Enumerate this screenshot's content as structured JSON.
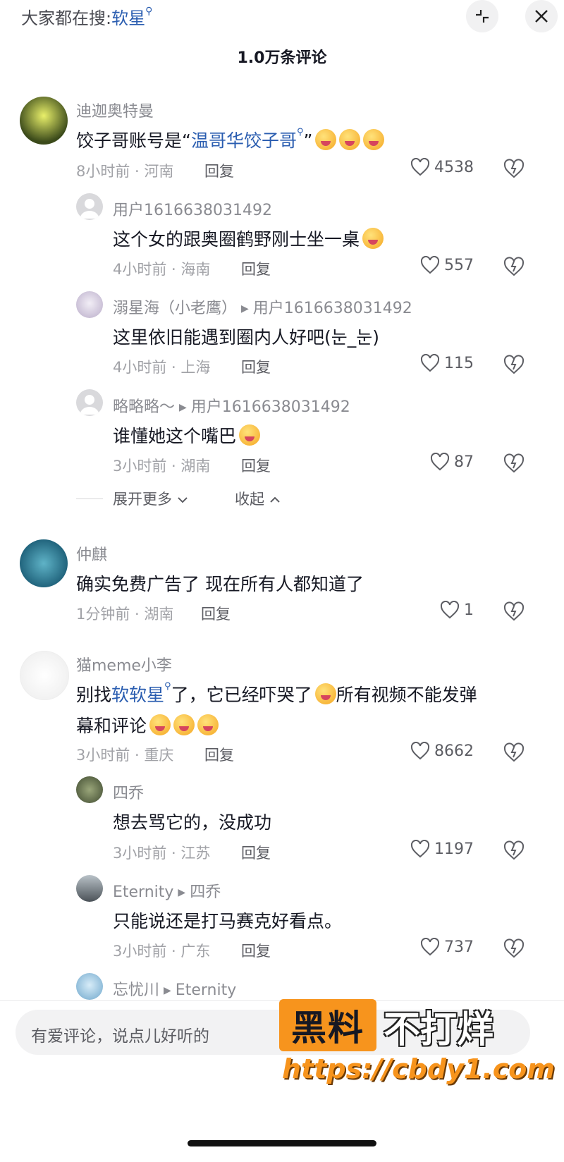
{
  "header": {
    "search_hint_prefix": "大家都在搜:",
    "search_hint_keyword": "软星",
    "comment_count": "1.0万条评论"
  },
  "colors": {
    "link": "#2a5db0",
    "text": "#161823",
    "meta": "#a1a2a7",
    "watermark_orange": "#f7941d"
  },
  "icons": [
    "search-icon",
    "collapse-icon",
    "close-icon",
    "heart-icon",
    "dislike-heart-icon",
    "chevron-down-icon",
    "chevron-up-icon",
    "play-triangle-icon"
  ],
  "comments": {
    "c1": {
      "username": "迪迦奥特曼",
      "text_a": "饺子哥账号是“",
      "text_link": "温哥华饺子哥",
      "text_b": "”",
      "time_location": "8小时前 · 河南",
      "reply": "回复",
      "likes": "4538"
    },
    "r1": {
      "username": "用户1616638031492",
      "text": "这个女的跟奥圈鹤野刚士坐一桌",
      "time_location": "4小时前 · 海南",
      "reply": "回复",
      "likes": "557"
    },
    "r2": {
      "username": "溺星海（小老鹰）",
      "reply_to": "用户1616638031492",
      "text": "这里依旧能遇到圈内人好吧(눈_눈)",
      "time_location": "4小时前 · 上海",
      "reply": "回复",
      "likes": "115"
    },
    "r3": {
      "username": "略略略～",
      "reply_to": "用户1616638031492",
      "text": "谁懂她这个嘴巴",
      "time_location": "3小时前 · 湖南",
      "reply": "回复",
      "likes": "87"
    },
    "expand_more": "展开更多",
    "collapse": "收起",
    "c2": {
      "username": "仲麒",
      "text": "确实免费广告了  现在所有人都知道了",
      "time_location": "1分钟前 · 湖南",
      "reply": "回复",
      "likes": "1"
    },
    "c3": {
      "username": "猫meme小李",
      "text_a": "别找",
      "text_link": "软软星",
      "text_b": "了，它已经吓哭了",
      "text_c": "所有视频不能发弹",
      "text_line2": "幕和评论",
      "time_location": "3小时前 · 重庆",
      "reply": "回复",
      "likes": "8662"
    },
    "r4": {
      "username": "四乔",
      "text": "想去骂它的，没成功",
      "time_location": "3小时前 · 江苏",
      "reply": "回复",
      "likes": "1197"
    },
    "r5": {
      "username": "Eternity",
      "reply_to": "四乔",
      "text": "只能说还是打马赛克好看点。",
      "time_location": "3小时前 · 广东",
      "reply": "回复",
      "likes": "737"
    },
    "r6": {
      "username": "忘忧川",
      "reply_to": "Eternity"
    }
  },
  "input": {
    "placeholder": "有爱评论，说点儿好听的"
  },
  "watermark": {
    "box_text": "黑料",
    "text": "不打烊",
    "url": "https://cbdy1.com"
  }
}
